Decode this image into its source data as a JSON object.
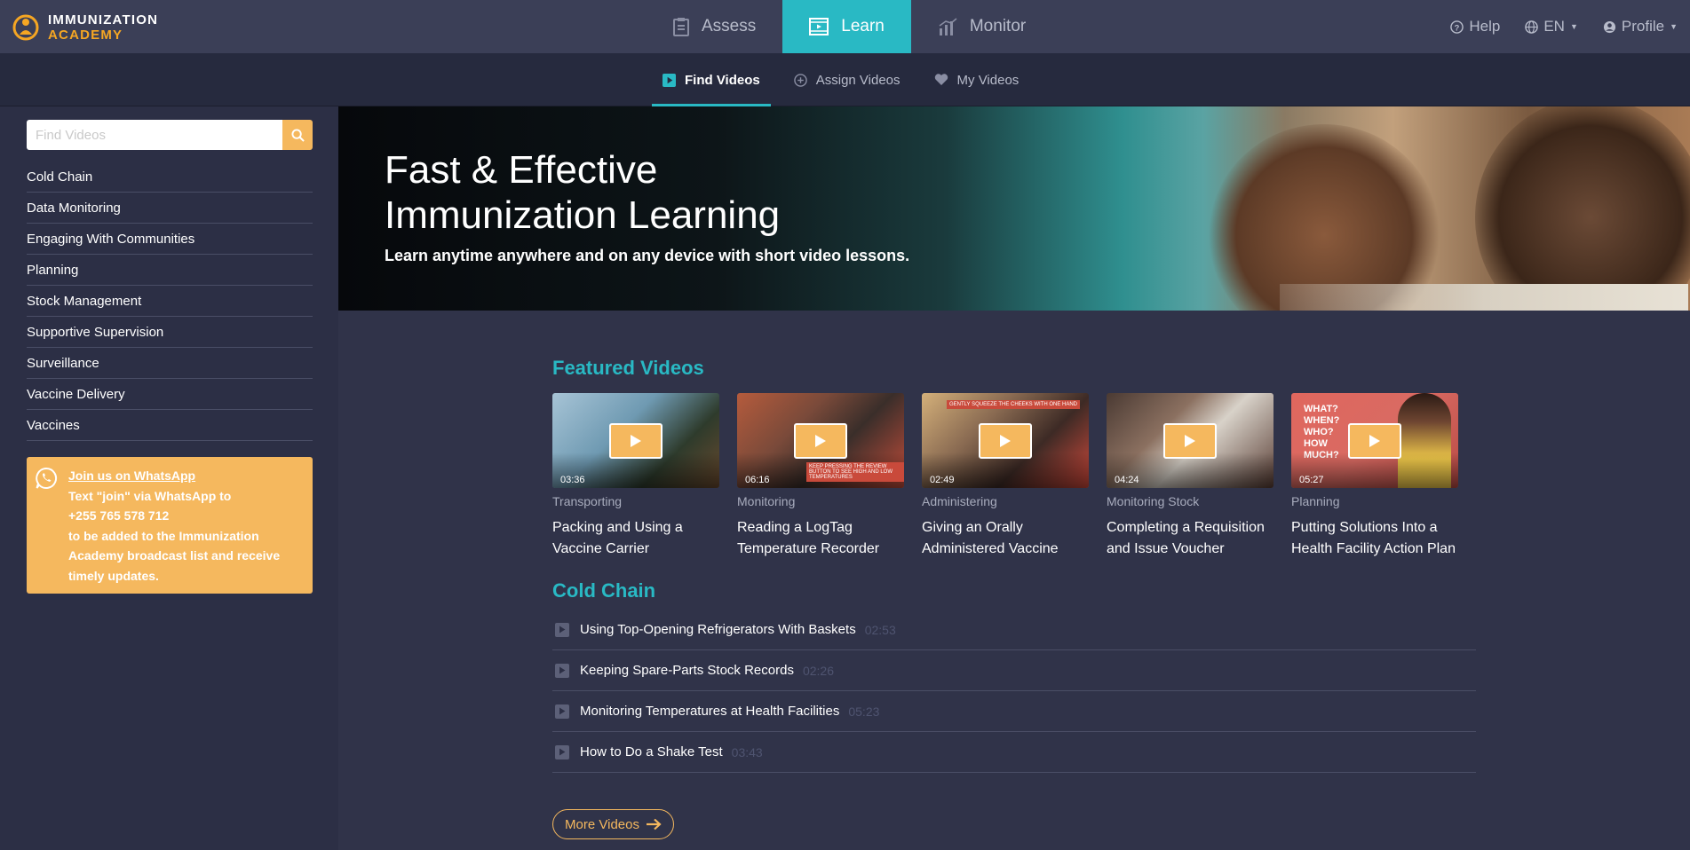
{
  "brand": {
    "line1": "IMMUNIZATION",
    "line2": "ACADEMY"
  },
  "mainnav": [
    {
      "label": "Assess",
      "icon": "clipboard-icon",
      "active": false
    },
    {
      "label": "Learn",
      "icon": "film-icon",
      "active": true
    },
    {
      "label": "Monitor",
      "icon": "bar-chart-icon",
      "active": false
    }
  ],
  "rightnav": {
    "help": "Help",
    "lang": "EN",
    "profile": "Profile"
  },
  "subnav": [
    {
      "label": "Find Videos",
      "icon": "play-square-icon",
      "active": true
    },
    {
      "label": "Assign Videos",
      "icon": "plus-circle-icon",
      "active": false
    },
    {
      "label": "My Videos",
      "icon": "heart-icon",
      "active": false
    }
  ],
  "search": {
    "placeholder": "Find Videos"
  },
  "categories": [
    "Cold Chain",
    "Data Monitoring",
    "Engaging With Communities",
    "Planning",
    "Stock Management",
    "Supportive Supervision",
    "Surveillance",
    "Vaccine Delivery",
    "Vaccines"
  ],
  "whatsapp": {
    "link": "Join us on WhatsApp",
    "line1": "Text \"join\" via WhatsApp to",
    "phone": "+255 765 578 712",
    "line3": "to be added to the Immunization Academy broadcast list and receive timely updates."
  },
  "hero": {
    "title_line1": "Fast & Effective",
    "title_line2": "Immunization Learning",
    "subtitle": "Learn anytime anywhere and on any device with short video lessons."
  },
  "featured": {
    "heading": "Featured Videos",
    "videos": [
      {
        "duration": "03:36",
        "category": "Transporting",
        "title": "Packing and Using a Vaccine Carrier"
      },
      {
        "duration": "06:16",
        "category": "Monitoring",
        "title": "Reading a LogTag Temperature Recorder"
      },
      {
        "duration": "02:49",
        "category": "Administering",
        "title": "Giving an Orally Administered Vaccine"
      },
      {
        "duration": "04:24",
        "category": "Monitoring Stock",
        "title": "Completing a Requisition and Issue Voucher"
      },
      {
        "duration": "05:27",
        "category": "Planning",
        "title": "Putting Solutions Into a Health Facility Action Plan"
      }
    ],
    "thumb_text": {
      "t2": "KEEP PRESSING THE REVIEW BUTTON TO SEE HIGH AND LOW TEMPERATURES",
      "t3": "GENTLY SQUEEZE THE CHEEKS WITH ONE HAND",
      "t5": "WHAT? WHEN? WHO? HOW MUCH?"
    }
  },
  "coldchain": {
    "heading": "Cold Chain",
    "videos": [
      {
        "title": "Using Top-Opening Refrigerators With Baskets",
        "duration": "02:53"
      },
      {
        "title": "Keeping Spare-Parts Stock Records",
        "duration": "02:26"
      },
      {
        "title": "Monitoring Temperatures at Health Facilities",
        "duration": "05:23"
      },
      {
        "title": "How to Do a Shake Test",
        "duration": "03:43"
      }
    ]
  },
  "more_button": "More Videos",
  "colors": {
    "accent": "#29b9c4",
    "orange": "#f5b85e",
    "background": "#2c2f45"
  }
}
